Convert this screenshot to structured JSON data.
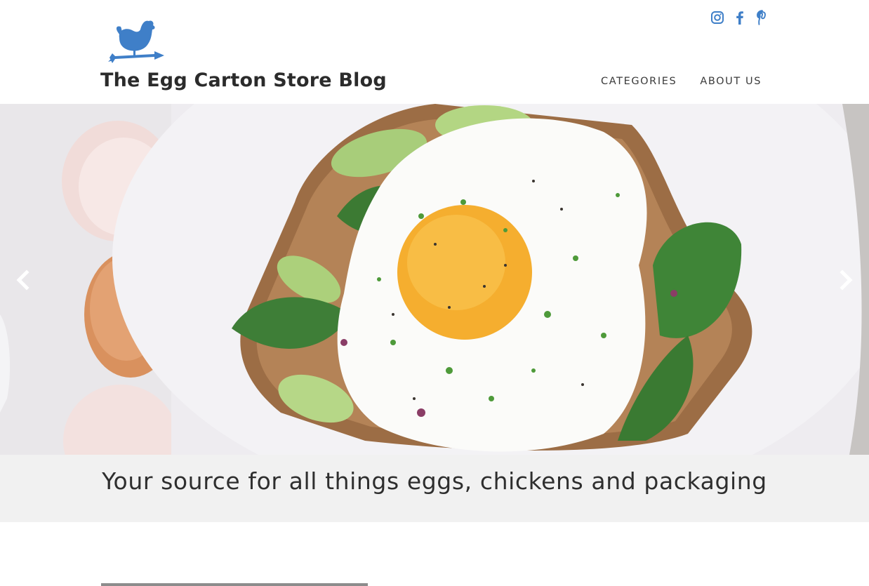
{
  "site": {
    "title": "The Egg Carton Store Blog",
    "logo_icon": "rooster-weathervane-icon",
    "brand_color": "#3f7fc8"
  },
  "social": [
    {
      "name": "instagram",
      "icon": "instagram-icon"
    },
    {
      "name": "facebook",
      "icon": "facebook-icon"
    },
    {
      "name": "pinterest",
      "icon": "pinterest-icon"
    }
  ],
  "nav": {
    "items": [
      "CATEGORIES",
      "ABOUT US"
    ]
  },
  "carousel": {
    "prev_icon": "chevron-left-icon",
    "next_icon": "chevron-right-icon",
    "slide_image": "fried-egg-avocado-toast-photo"
  },
  "tagline": "Your source for all things eggs, chickens and packaging"
}
